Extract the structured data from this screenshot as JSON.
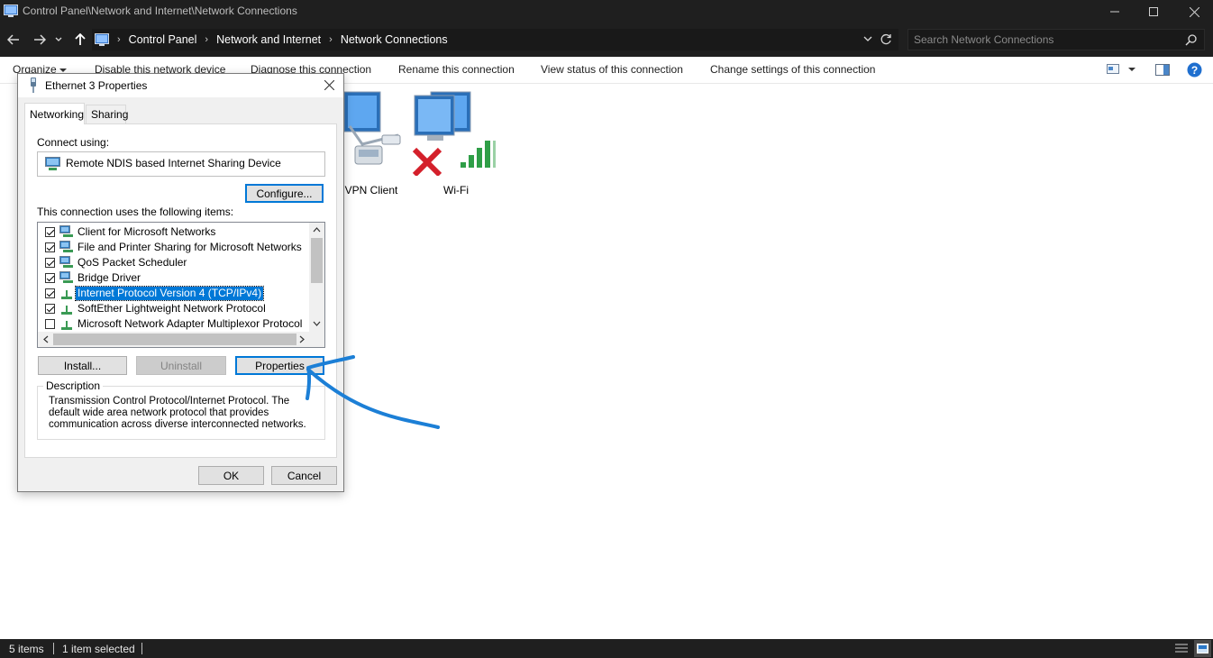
{
  "window": {
    "title": "Control Panel\\Network and Internet\\Network Connections"
  },
  "address": {
    "crumbs": [
      "Control Panel",
      "Network and Internet",
      "Network Connections"
    ],
    "search_placeholder": "Search Network Connections"
  },
  "commands": {
    "organize": "Organize",
    "disable": "Disable this network device",
    "diagnose": "Diagnose this connection",
    "rename": "Rename this connection",
    "view_status": "View status of this connection",
    "change_settings": "Change settings of this connection"
  },
  "connections": [
    {
      "label": "VPN Client",
      "icon": "vpn-adapter-icon"
    },
    {
      "label": "Wi-Fi",
      "icon": "wifi-adapter-disconnected-icon"
    }
  ],
  "status": {
    "items": "5 items",
    "selected": "1 item selected"
  },
  "dialog": {
    "title": "Ethernet 3 Properties",
    "tabs": [
      "Networking",
      "Sharing"
    ],
    "connect_using_label": "Connect using:",
    "device": "Remote NDIS based Internet Sharing Device",
    "configure": "Configure...",
    "items_label": "This connection uses the following items:",
    "items": [
      {
        "label": "Client for Microsoft Networks",
        "checked": true,
        "icon": "network-client-icon"
      },
      {
        "label": "File and Printer Sharing for Microsoft Networks",
        "checked": true,
        "icon": "network-service-icon"
      },
      {
        "label": "QoS Packet Scheduler",
        "checked": true,
        "icon": "network-service-icon"
      },
      {
        "label": "Bridge Driver",
        "checked": true,
        "icon": "network-service-icon"
      },
      {
        "label": "Internet Protocol Version 4 (TCP/IPv4)",
        "checked": true,
        "icon": "protocol-icon",
        "selected": true
      },
      {
        "label": "SoftEther Lightweight Network Protocol",
        "checked": true,
        "icon": "protocol-icon"
      },
      {
        "label": "Microsoft Network Adapter Multiplexor Protocol",
        "checked": false,
        "icon": "protocol-icon"
      }
    ],
    "install": "Install...",
    "uninstall": "Uninstall",
    "properties": "Properties",
    "description_legend": "Description",
    "description": "Transmission Control Protocol/Internet Protocol. The default wide area network protocol that provides communication across diverse interconnected networks.",
    "ok": "OK",
    "cancel": "Cancel"
  },
  "colors": {
    "titlebar": "#1f1f1f",
    "accent": "#0078d7",
    "annotation": "#1c7fd6"
  }
}
